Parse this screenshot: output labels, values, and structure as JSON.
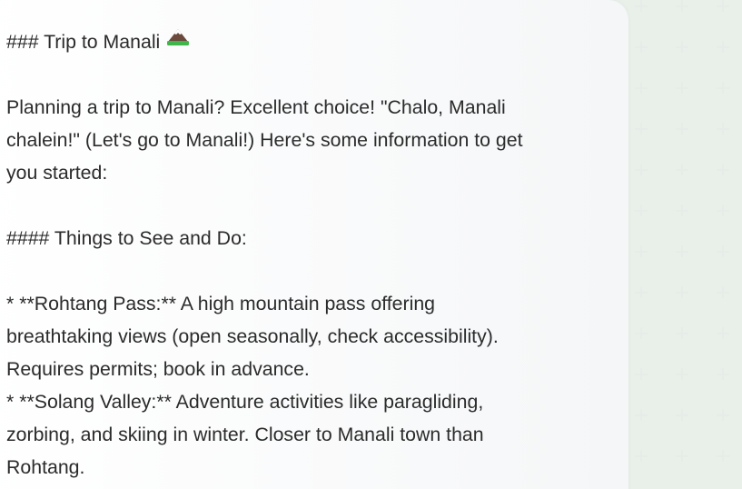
{
  "message": {
    "heading": "### Trip to Manali",
    "heading_icon": "mountain-emoji",
    "intro_line1": "Planning a trip to Manali? Excellent choice! \"Chalo, Manali",
    "intro_line2": "chalein!\" (Let's go to Manali!) Here's some information to get",
    "intro_line3": "you started:",
    "subheading": "#### Things to See and Do:",
    "item1_line1": "* **Rohtang Pass:** A high mountain pass offering",
    "item1_line2": "breathtaking views (open seasonally, check accessibility).",
    "item1_line3": "Requires permits; book in advance.",
    "item2_line1": "* **Solang Valley:** Adventure activities like paragliding,",
    "item2_line2": "zorbing, and skiing in winter. Closer to Manali town than",
    "item2_line3": "Rohtang."
  },
  "colors": {
    "text": "#2b2b2b",
    "background": "#ffffff",
    "bubble": "#f6f7f8",
    "grid_plus": "#e8eeea"
  }
}
